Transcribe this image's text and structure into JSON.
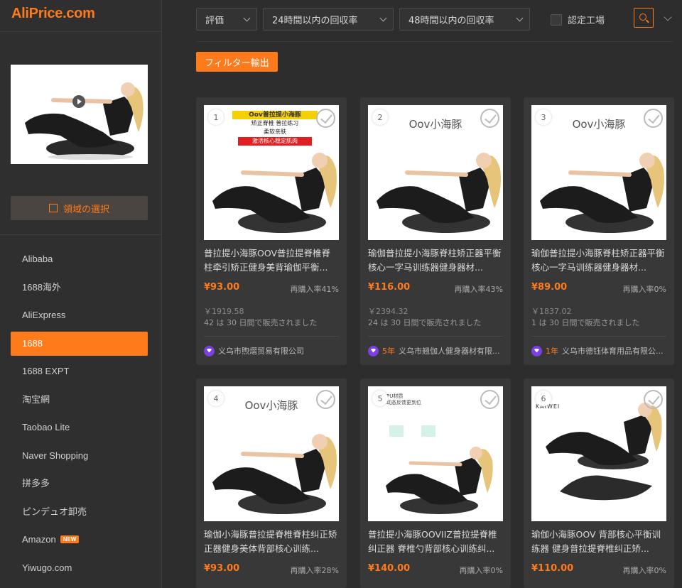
{
  "app": {
    "logo": "AliPrice.com"
  },
  "sidebar": {
    "select_area_label": "領域の選択",
    "items": [
      {
        "label": "Alibaba"
      },
      {
        "label": "1688海外"
      },
      {
        "label": "AliExpress"
      },
      {
        "label": "1688",
        "active": true
      },
      {
        "label": "1688 EXPT"
      },
      {
        "label": "淘宝網"
      },
      {
        "label": "Taobao Lite"
      },
      {
        "label": "Naver Shopping"
      },
      {
        "label": "拼多多"
      },
      {
        "label": "ピンデュオ卸売"
      },
      {
        "label": "Amazon",
        "badge": "NEW"
      },
      {
        "label": "Yiwugo.com"
      }
    ]
  },
  "toolbar": {
    "sort": "評価",
    "filter24": "24時間以内の回収率",
    "filter48": "48時間以内の回収率",
    "certified": "認定工場",
    "export_label": "フィルター輸出"
  },
  "products": [
    {
      "num": "1",
      "title": "普拉提小海豚OOV普拉提脊椎脊柱牵引矫正健身美背瑜伽平衡...",
      "price": "¥93.00",
      "rebuy": "再購入率41%",
      "oldprice": "￥1919.58",
      "sold": "42 は 30 日間で販売されました",
      "years": "",
      "supplier": "义乌市煦熠贸易有限公司",
      "img_text": "",
      "banner": [
        "Oov普拉提小海豚",
        "矫正脊椎 普拉练习",
        "柔软亲肤",
        "激活核心稳定肌肉"
      ]
    },
    {
      "num": "2",
      "title": "瑜伽普拉提小海豚脊柱矫正器平衡核心一字马训练器健身器材...",
      "price": "¥116.00",
      "rebuy": "再購入率43%",
      "oldprice": "￥2394.32",
      "sold": "24 は 30 日間で販売されました",
      "years": "5年",
      "supplier": "义乌市翘伽人健身器材有限...",
      "img_text": "Oov小海豚"
    },
    {
      "num": "3",
      "title": "瑜伽普拉提小海豚脊柱矫正器平衡核心一字马训练器健身器材...",
      "price": "¥89.00",
      "rebuy": "再購入率0%",
      "oldprice": "￥1837.02",
      "sold": "1 は 30 日間で販売されました",
      "years": "1年",
      "supplier": "义乌市德钰体育用品有限公...",
      "img_text": "Oov小海豚"
    },
    {
      "num": "4",
      "title": "瑜伽小海豚普拉提脊椎脊柱纠正矫正器健身美体背部核心训练...",
      "price": "¥93.00",
      "rebuy": "再購入率28%",
      "img_text": "Oov小海豚"
    },
    {
      "num": "5",
      "title": "普拉提小海豚OOVIIZ普拉提脊椎纠正器 脊椎勺背部核心训练纠...",
      "price": "¥140.00",
      "rebuy": "再購入率0%",
      "img_text": "",
      "tiny_ad": [
        "柔性PU材质",
        "身体动态反馈更到位"
      ]
    },
    {
      "num": "6",
      "title": "瑜伽小海豚OOV 背部核心平衡训练器 健身普拉提脊椎纠正矫...",
      "price": "¥110.00",
      "rebuy": "再購入率0%",
      "img_text": "",
      "brand": "KAIWEI"
    }
  ]
}
